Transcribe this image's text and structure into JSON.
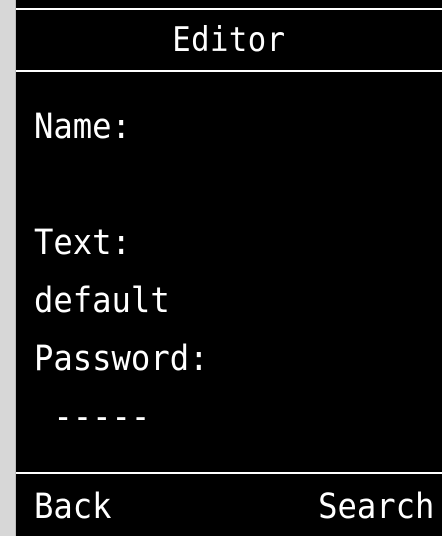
{
  "window": {
    "title": "Editor"
  },
  "form": {
    "name_label": "Name:",
    "name_value": "",
    "text_label": "Text:",
    "text_value": "default",
    "password_label": "Password:",
    "password_value": " -----"
  },
  "softkeys": {
    "left_label": "Back",
    "right_label": "Search"
  },
  "colors": {
    "background": "#000000",
    "foreground": "#ffffff",
    "bezel": "#d7d7d7"
  }
}
